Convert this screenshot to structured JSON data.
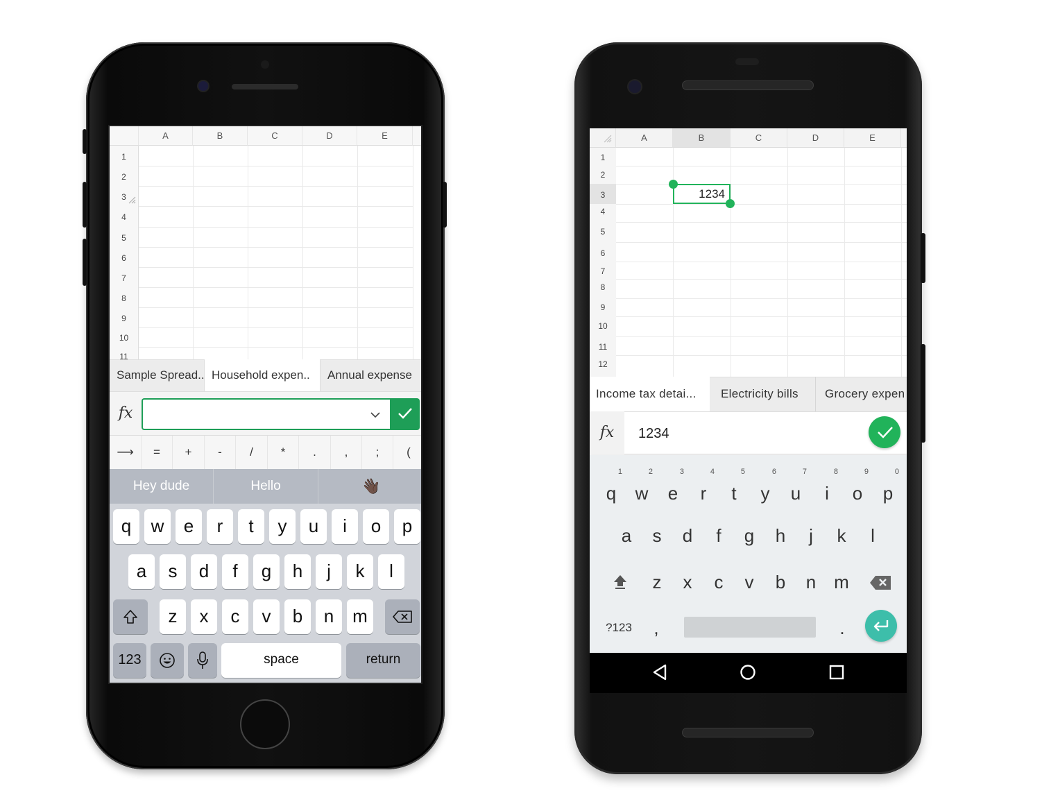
{
  "ios": {
    "columns": [
      "A",
      "B",
      "C",
      "D",
      "E"
    ],
    "rows": [
      "1",
      "2",
      "3",
      "4",
      "5",
      "6",
      "7",
      "8",
      "9",
      "10",
      "11"
    ],
    "sheet_tabs": [
      "Sample Spread..",
      "Household expen..",
      "Annual expense"
    ],
    "formula": {
      "fx_label": "fx",
      "value": ""
    },
    "symbols": [
      "⟶",
      "=",
      "+",
      "-",
      "/",
      "*",
      ".",
      ",",
      ";",
      "("
    ],
    "suggestions": [
      "Hey dude",
      "Hello",
      "👋🏿"
    ],
    "keyboard": {
      "row1": [
        "q",
        "w",
        "e",
        "r",
        "t",
        "y",
        "u",
        "i",
        "o",
        "p"
      ],
      "row2": [
        "a",
        "s",
        "d",
        "f",
        "g",
        "h",
        "j",
        "k",
        "l"
      ],
      "row3": [
        "z",
        "x",
        "c",
        "v",
        "b",
        "n",
        "m"
      ],
      "numbers_label": "123",
      "space_label": "space",
      "return_label": "return"
    },
    "accent": "#1e9e57"
  },
  "android": {
    "columns": [
      "A",
      "B",
      "C",
      "D",
      "E"
    ],
    "rows": [
      "1",
      "2",
      "3",
      "4",
      "5",
      "6",
      "7",
      "8",
      "9",
      "10",
      "11",
      "12"
    ],
    "selected_cell": {
      "ref": "B3",
      "value": "1234"
    },
    "sheet_tabs": [
      "Income tax detai...",
      "Electricity bills",
      "Grocery expen"
    ],
    "formula": {
      "fx_label": "fx",
      "value": "1234"
    },
    "keyboard": {
      "row1": [
        "q",
        "w",
        "e",
        "r",
        "t",
        "y",
        "u",
        "i",
        "o",
        "p"
      ],
      "row1_hints": [
        "1",
        "2",
        "3",
        "4",
        "5",
        "6",
        "7",
        "8",
        "9",
        "0"
      ],
      "row2": [
        "a",
        "s",
        "d",
        "f",
        "g",
        "h",
        "j",
        "k",
        "l"
      ],
      "row3": [
        "z",
        "x",
        "c",
        "v",
        "b",
        "n",
        "m"
      ],
      "symbols_label": "?123",
      "comma_label": ",",
      "period_label": "."
    },
    "accent": "#21b35a",
    "enter_color": "#3dbeaa"
  }
}
